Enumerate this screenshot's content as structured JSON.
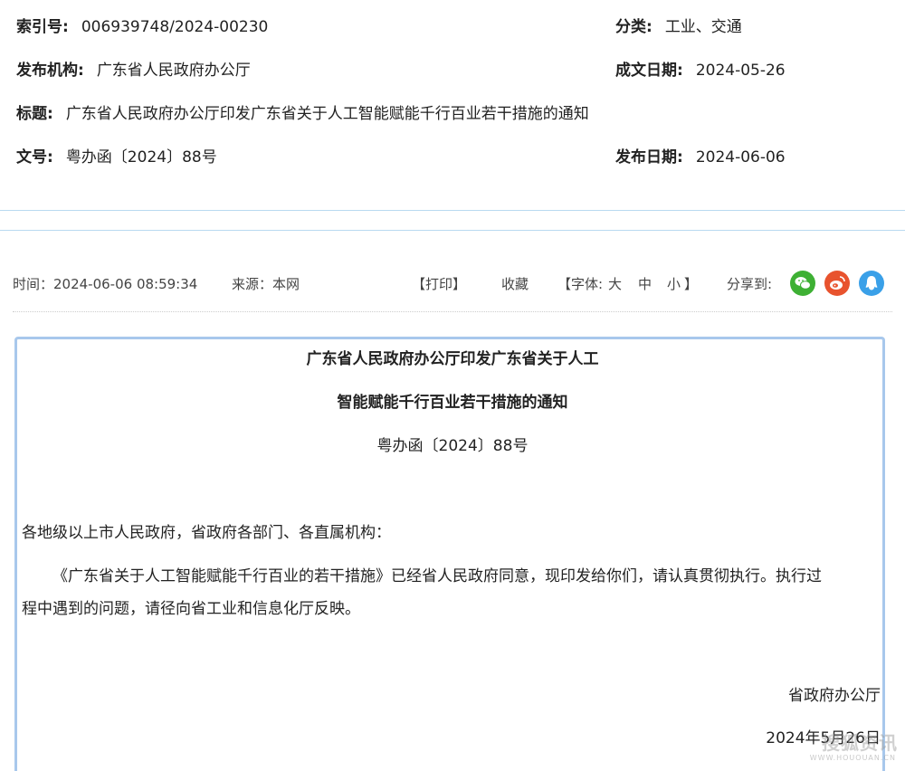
{
  "meta": {
    "index": {
      "label": "索引号:",
      "value": "006939748/2024-00230"
    },
    "category": {
      "label": "分类:",
      "value": "工业、交通"
    },
    "publisher": {
      "label": "发布机构:",
      "value": "广东省人民政府办公厅"
    },
    "written_date": {
      "label": "成文日期:",
      "value": "2024-05-26"
    },
    "title": {
      "label": "标题:",
      "value": "广东省人民政府办公厅印发广东省关于人工智能赋能千行百业若干措施的通知"
    },
    "doc_number": {
      "label": "文号:",
      "value": "粤办函〔2024〕88号"
    },
    "publish_date": {
      "label": "发布日期:",
      "value": "2024-06-06"
    }
  },
  "toolbar": {
    "time": "时间：2024-06-06 08:59:34",
    "source": "来源：本网",
    "print": "【打印】",
    "favorite": "收藏",
    "font_label": "【字体:",
    "font_large": "大",
    "font_medium": "中",
    "font_small": "小",
    "font_close": "】",
    "share_label": "分享到:",
    "share_icons": [
      "wechat-icon",
      "weibo-icon",
      "qq-icon"
    ],
    "share_colors": {
      "wechat": "#3eb034",
      "weibo": "#e8532e",
      "qq": "#3aa0e8"
    }
  },
  "document": {
    "title_line1": "广东省人民政府办公厅印发广东省关于人工",
    "title_line2": "智能赋能千行百业若干措施的通知",
    "doc_number": "粤办函〔2024〕88号",
    "salutation": "各地级以上市人民政府，省政府各部门、各直属机构：",
    "body_line1": "《广东省关于人工智能赋能千行百业的若干措施》已经省人民政府同意，现印发给你们，请认真贯彻执行。执行过",
    "body_line2": "程中遇到的问题，请径向省工业和信息化厅反映。",
    "signature": "省政府办公厅",
    "date": "2024年5月26日"
  },
  "watermark": {
    "text": "搜狐资讯",
    "sub": "WWW.HOUOUAN.CN"
  },
  "colors": {
    "border": "#a8c8ec",
    "separator": "#b9daf0"
  }
}
